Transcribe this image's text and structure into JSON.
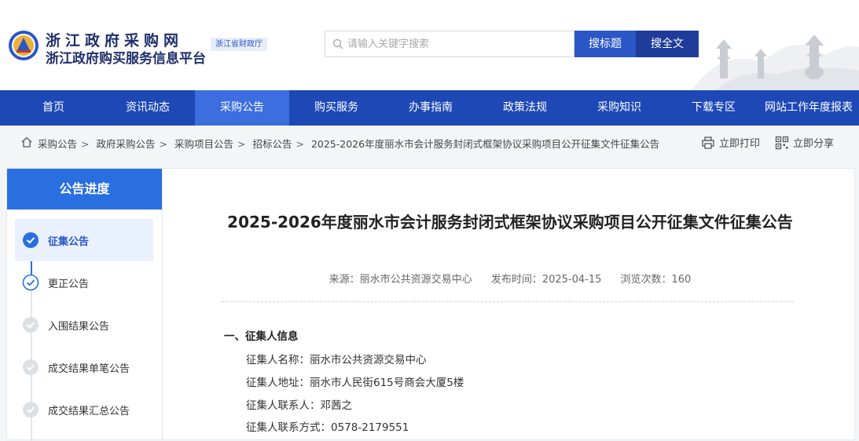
{
  "header": {
    "site_title": "浙江政府采购网",
    "site_subtitle": "浙江政府购买服务信息平台",
    "dept_tag": "浙江省财政厅",
    "search_placeholder": "请输入关键字搜索",
    "btn_search_title": "搜标题",
    "btn_search_full": "搜全文"
  },
  "nav": {
    "items": [
      "首页",
      "资讯动态",
      "采购公告",
      "购买服务",
      "办事指南",
      "政策法规",
      "采购知识",
      "下载专区",
      "网站工作年度报表"
    ],
    "active_index": 2
  },
  "breadcrumb": {
    "items": [
      "采购公告",
      "政府采购公告",
      "采购项目公告",
      "招标公告",
      "2025-2026年度丽水市会计服务封闭式框架协议采购项目公开征集文件征集公告"
    ],
    "separator": ">"
  },
  "actions": {
    "print": "立即打印",
    "share": "立即分享"
  },
  "sidebar": {
    "title": "公告进度",
    "steps": [
      {
        "label": "征集公告",
        "state": "current"
      },
      {
        "label": "更正公告",
        "state": "done"
      },
      {
        "label": "入围结果公告",
        "state": "pending"
      },
      {
        "label": "成交结果单笔公告",
        "state": "pending"
      },
      {
        "label": "成交结果汇总公告",
        "state": "pending"
      }
    ]
  },
  "article": {
    "title": "2025-2026年度丽水市会计服务封闭式框架协议采购项目公开征集文件征集公告",
    "source": "来源：丽水市公共资源交易中心",
    "publish_time": "发布时间：2025-04-15",
    "views": "浏览次数：160",
    "section1_title": "一、征集人信息",
    "info": [
      "征集人名称：丽水市公共资源交易中心",
      "征集人地址：丽水市人民街615号商会大厦5楼",
      "征集人联系人：邓茜之",
      "征集人联系方式：0578-2179551"
    ]
  },
  "colors": {
    "nav_bg": "#1e48b6",
    "nav_active": "#3d6ee0",
    "primary": "#2a6fe0",
    "title_text": "#1f2f6b"
  }
}
